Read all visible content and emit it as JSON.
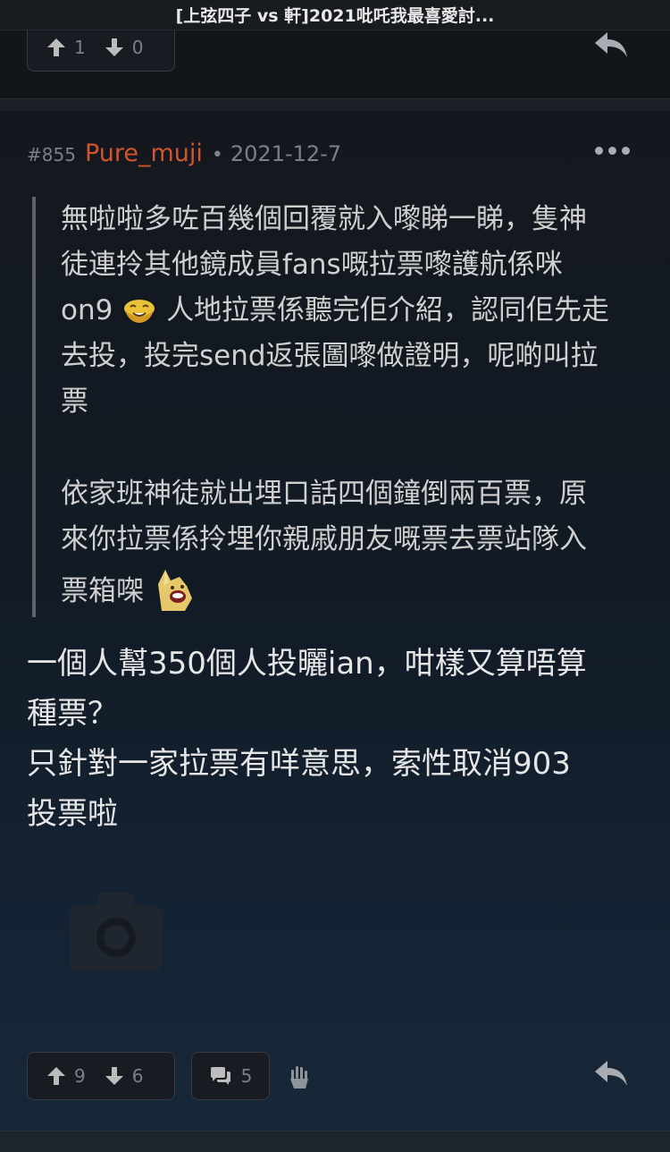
{
  "window": {
    "title": "[上弦四子 vs 軒]2021吡吒我最喜愛討..."
  },
  "previous_post": {
    "upvotes": "1",
    "downvotes": "0",
    "reply_icon": "reply-icon"
  },
  "post": {
    "number": "#855",
    "author": "Pure_muji",
    "separator": "•",
    "date": "2021-12-7",
    "more_icon": "more-icon",
    "quote": {
      "paragraph1_lines": [
        "無啦啦多咗百幾個回覆就入嚟睇一睇，隻神",
        "徒連拎其他鏡成員fans嘅拉票嚟護航係咪"
      ],
      "paragraph1_line3_before_emoji": "on9",
      "paragraph1_line3_after_emoji": "人地拉票係聽完佢介紹，認同佢先走",
      "paragraph1_tail_lines": [
        "去投，投完send返張圖嚟做證明，呢啲叫拉",
        "票"
      ],
      "paragraph2_lines": [
        "依家班神徒就出埋口話四個鐘倒兩百票，原",
        "來你拉票係拎埋你親戚朋友嘅票去票站隊入"
      ],
      "paragraph2_last_line": "票箱㗎",
      "emoji1": "smiling-face-emoji",
      "emoji2": "shocked-face-emoji"
    },
    "body_lines": [
      "一個人幫350個人投曬ian，咁樣又算唔算",
      "種票？",
      "只針對一家拉票有咩意思，索性取消903",
      "投票啦"
    ],
    "image_placeholder_icon": "camera-icon",
    "upvotes": "9",
    "downvotes": "6",
    "comments": "5",
    "hand_icon": "hand-icon",
    "reply_icon": "reply-icon"
  },
  "colors": {
    "author": "#d0552e",
    "background": "#14181e",
    "muted_text": "#7b7f86"
  }
}
